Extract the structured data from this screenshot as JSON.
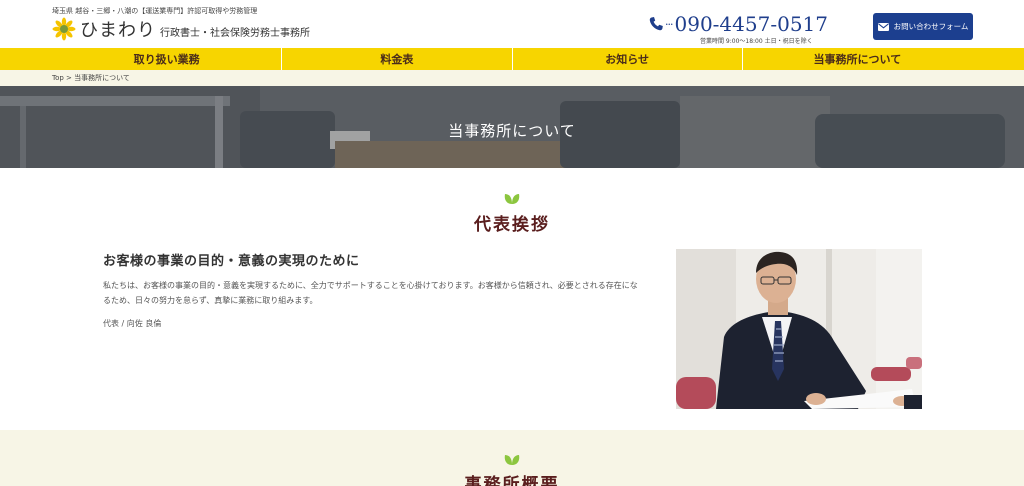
{
  "header": {
    "tagline": "埼玉県 越谷・三郷・八潮の【運送業専門】許認可取得や労務管理",
    "logo_name": "ひまわり",
    "logo_sub": "行政書士・社会保険労務士事務所",
    "phone_dots": "···",
    "phone": "090-4457-0517",
    "hours": "営業時間 9:00～18:00 土日・祝日を除く",
    "contact_label": "お問い合わせフォーム"
  },
  "nav": {
    "items": [
      {
        "label": "取り扱い業務"
      },
      {
        "label": "料金表"
      },
      {
        "label": "お知らせ"
      },
      {
        "label": "当事務所について"
      }
    ]
  },
  "breadcrumb": {
    "text": "Top > 当事務所について"
  },
  "hero": {
    "title": "当事務所について"
  },
  "greeting": {
    "section_title": "代表挨拶",
    "heading": "お客様の事業の目的・意義の実現のために",
    "body": "私たちは、お客様の事業の目的・意義を実現するために、全力でサポートすることを心掛けております。お客様から信頼され、必要とされる存在になるため、日々の努力を怠らず、真摯に業務に取り組みます。",
    "signature": "代表 / 向佐 良倫"
  },
  "overview": {
    "section_title": "事務所概要"
  },
  "colors": {
    "nav_bg": "#f7d500",
    "brand_blue": "#1c3f8f",
    "heading_brown": "#5a1e1e",
    "leaf_green": "#8cc63f",
    "band_bg": "#f7f5e6"
  }
}
